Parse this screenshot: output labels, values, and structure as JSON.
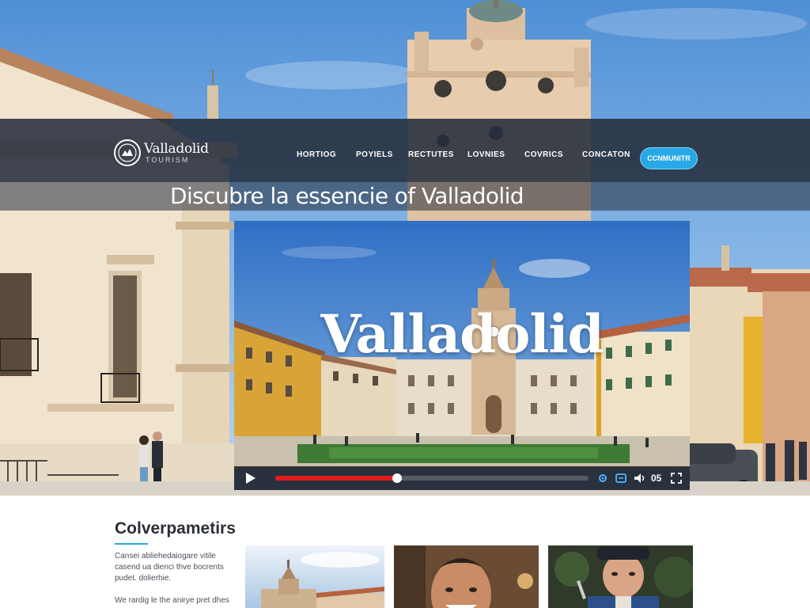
{
  "brand": {
    "name": "Valladolid",
    "tagline": "TOURISM"
  },
  "nav": {
    "items": [
      "HORTIOG",
      "POYIELS",
      "RECTUTES",
      "LOVNIES",
      "COVRICS",
      "CONCATON"
    ],
    "cta_label": "CCNMUNITR"
  },
  "headline": "Discubre la essencie of Valladolid",
  "video": {
    "title": "Valladolid",
    "progress": 0.39,
    "time": "05",
    "colors": {
      "progress": "#e11b1b",
      "bar": "#141418"
    }
  },
  "section": {
    "title": "Colverpametirs",
    "paragraph1": "Cansei abliehedaiogare vitile casend ua dienci thve bocrents pudet. dolierhie.",
    "paragraph2": "We rardig le the anirye pret dhes"
  },
  "cards": [
    {
      "icon": "cathedral-photo"
    },
    {
      "icon": "smiling-man-photo"
    },
    {
      "icon": "chef-photo"
    }
  ],
  "colors": {
    "accent": "#28a8e6",
    "navbar": "#262e3c"
  }
}
